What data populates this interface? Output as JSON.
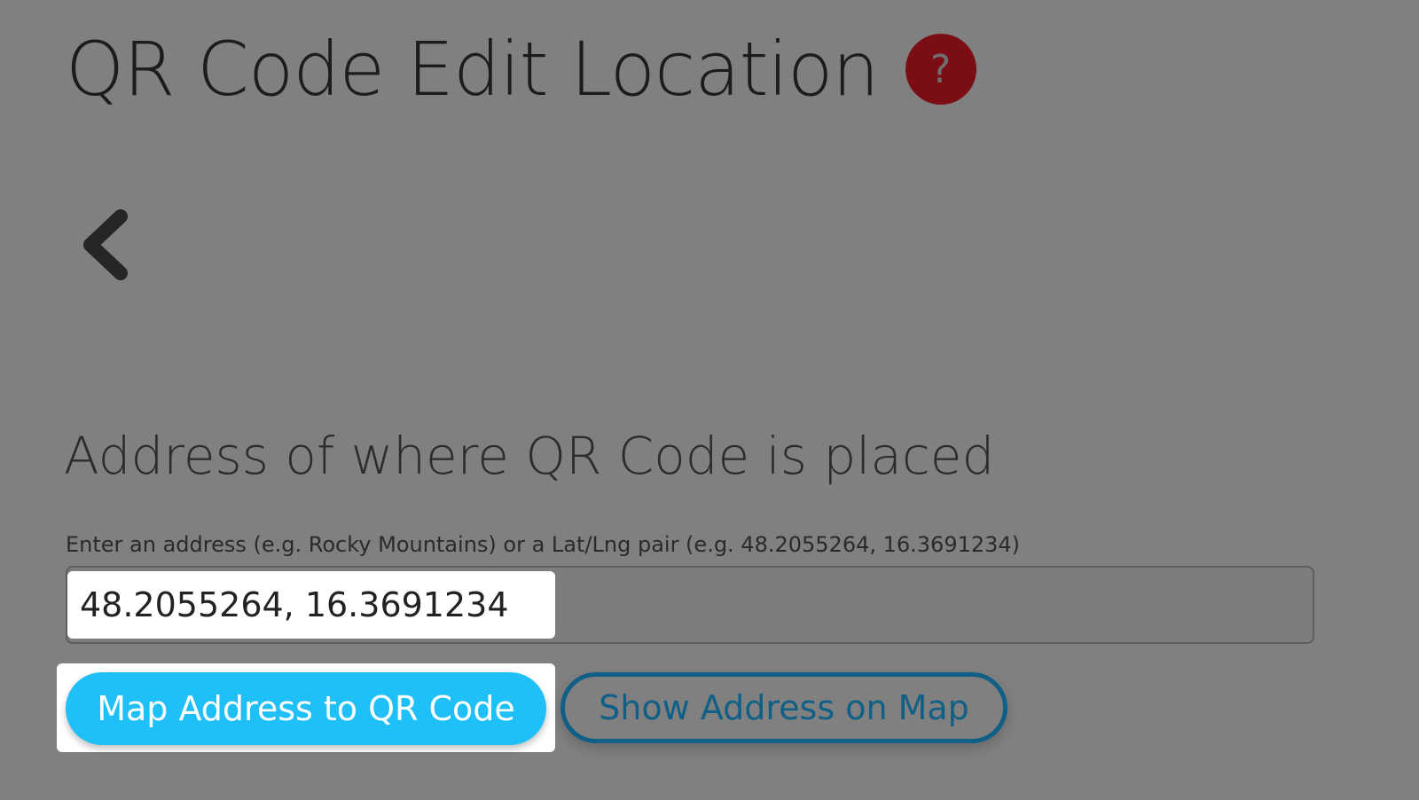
{
  "header": {
    "title": "QR Code Edit Location",
    "help_icon": "question-mark-icon",
    "help_symbol": "?"
  },
  "nav": {
    "back_icon": "chevron-left-icon"
  },
  "address_section": {
    "heading": "Address of where QR Code is placed",
    "field_label": "Enter an address (e.g. Rocky Mountains) or a Lat/Lng pair (e.g. 48.2055264, 16.3691234)",
    "input_value": "48.2055264, 16.3691234"
  },
  "actions": {
    "map_button_label": "Map Address to QR Code",
    "show_map_button_label": "Show Address on Map"
  },
  "colors": {
    "overlay_background": "#808080",
    "help_badge": "#7a0e14",
    "primary_button": "#1ec0f7",
    "secondary_button_border": "#0f5f86"
  }
}
